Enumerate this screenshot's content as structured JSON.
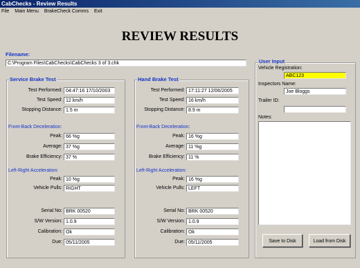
{
  "window": {
    "title": "CabChecks - Review Results"
  },
  "menu": [
    "File",
    "Main Menu",
    "BrakeCheck Comms",
    "Exit"
  ],
  "page_title": "REVIEW RESULTS",
  "filename": {
    "label": "Filename:",
    "value": "C:\\Program Files\\CabChecks\\CabChecks 3 of 3.chk"
  },
  "service": {
    "title": "Service Brake Test",
    "test_performed": {
      "label": "Test Performed:",
      "value": "04:47:16 17/10/2003"
    },
    "test_speed": {
      "label": "Test Speed:",
      "value": "12 km/h"
    },
    "stopping_distance": {
      "label": "Stopping Distance:",
      "value": "1.5 m"
    },
    "fb_title": "Front-Back Deceleration:",
    "peak": {
      "label": "Peak:",
      "value": "66 %g"
    },
    "average": {
      "label": "Average:",
      "value": "37 %g"
    },
    "brake_eff": {
      "label": "Brake Efficiency:",
      "value": "37 %"
    },
    "lr_title": "Left-Right Acceleration:",
    "lr_peak": {
      "label": "Peak:",
      "value": "10 %g"
    },
    "vehicle_pulls": {
      "label": "Vehicle Pulls:",
      "value": "RIGHT"
    },
    "serial": {
      "label": "Serial No:",
      "value": "BRK 00520"
    },
    "sw_version": {
      "label": "S/W Version:",
      "value": "1.0.9"
    },
    "calibration": {
      "label": "Calibration:",
      "value": "Ok"
    },
    "due": {
      "label": "Due:",
      "value": "05/11/2005"
    }
  },
  "hand": {
    "title": "Hand Brake Test",
    "test_performed": {
      "label": "Test Performed:",
      "value": "17:11:27 12/06/2005"
    },
    "test_speed": {
      "label": "Test Speed:",
      "value": "16 km/h"
    },
    "stopping_distance": {
      "label": "Stopping Distance:",
      "value": "8.9 m"
    },
    "fb_title": "Front-Back Deceleration:",
    "peak": {
      "label": "Peak:",
      "value": "16 %g"
    },
    "average": {
      "label": "Average:",
      "value": "11 %g"
    },
    "brake_eff": {
      "label": "Brake Efficiency:",
      "value": "11 %"
    },
    "lr_title": "Left-Right Acceleration:",
    "lr_peak": {
      "label": "Peak:",
      "value": "16 %g"
    },
    "vehicle_pulls": {
      "label": "Vehicle Pulls:",
      "value": "LEFT"
    },
    "serial": {
      "label": "Serial No:",
      "value": "BRK 00520"
    },
    "sw_version": {
      "label": "S/W Version:",
      "value": "1.0.9"
    },
    "calibration": {
      "label": "Calibration:",
      "value": "Ok"
    },
    "due": {
      "label": "Due:",
      "value": "05/11/2005"
    }
  },
  "user_input": {
    "title": "User Input",
    "vehicle_reg": {
      "label": "Vehicle Registration:",
      "value": "ABC123"
    },
    "inspector": {
      "label": "Inspectors Name:",
      "value": "Joe Bloggs"
    },
    "trailer": {
      "label": "Trailer ID:",
      "value": ""
    },
    "notes": {
      "label": "Notes:",
      "value": ""
    },
    "save_btn": "Save to Disk",
    "load_btn": "Load from Disk"
  },
  "colors": {
    "highlight": "#ffff00",
    "accent": "#1533c8"
  }
}
